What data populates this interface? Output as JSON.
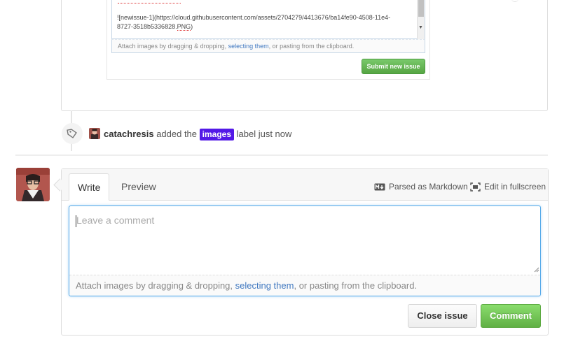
{
  "previous_comment": {
    "textarea_text_line1": "![newissue-1](https://cloud.githubusercontent.com/assets/2704279/4413676/ba14fe90-4508-11e4-",
    "textarea_text_line2_a": "8727-3518b5336828.",
    "textarea_text_line2_spell": "PNG",
    "textarea_text_line2_b": ")",
    "attach_prefix": "Attach images by dragging & dropping, ",
    "attach_link": "selecting them",
    "attach_suffix": ", or pasting from the clipboard.",
    "submit_label": "Submit new issue"
  },
  "event": {
    "author": "catachresis",
    "action": "added the",
    "label_name": "images",
    "label_color": "#5319e7",
    "suffix": "label just now",
    "icon": "tag-icon"
  },
  "comment_form": {
    "tabs": [
      {
        "label": "Write",
        "selected": true
      },
      {
        "label": "Preview",
        "selected": false
      }
    ],
    "markdown_note": "Parsed as Markdown",
    "fullscreen_label": "Edit in fullscreen",
    "placeholder": "Leave a comment",
    "attach_prefix": "Attach images by dragging & dropping, ",
    "attach_link": "selecting them",
    "attach_suffix": ", or pasting from the clipboard.",
    "close_button": "Close issue",
    "comment_button": "Comment"
  },
  "colors": {
    "accent_link": "#4078c0",
    "primary_green": "#60b044",
    "focus_blue": "#51a7e8"
  }
}
